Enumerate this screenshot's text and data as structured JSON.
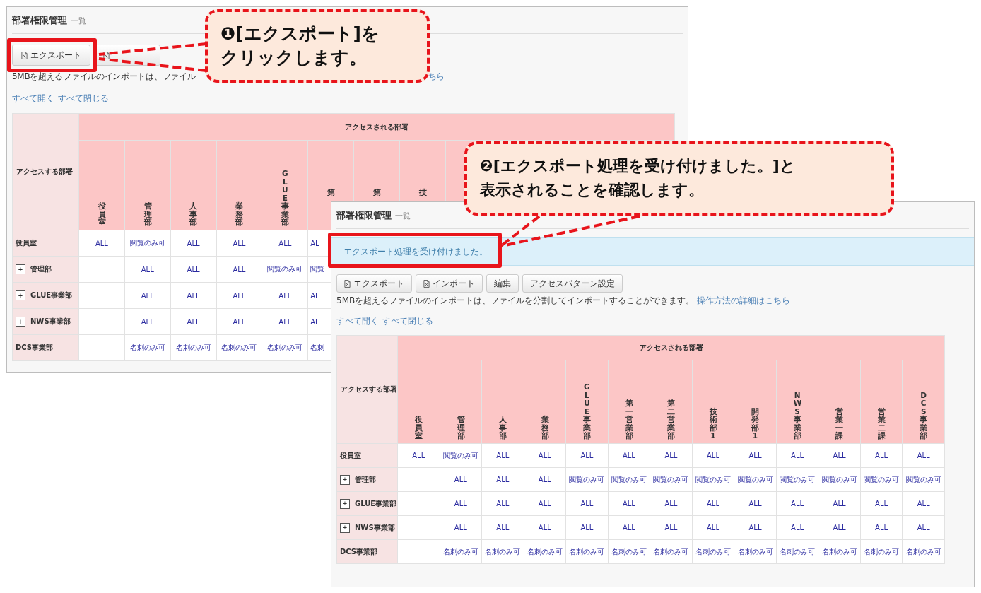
{
  "back_window": {
    "title": "部署権限管理",
    "subtitle": "一覧",
    "buttons": [
      {
        "label": "エクスポート",
        "icon": true
      },
      {
        "icon": true
      }
    ],
    "note": "5MBを超えるファイルのインポートは、ファイル",
    "note_link": "ちら",
    "expand_all": "すべて開く",
    "collapse_all": "すべて閉じる",
    "table": {
      "corner": "アクセスする部署",
      "group_header": "アクセスされる部署",
      "columns": [
        {
          "label": "役員室"
        },
        {
          "label": "管理部"
        },
        {
          "label": "人事部"
        },
        {
          "label": "業務部"
        },
        {
          "label": "GLUE事業部"
        },
        {
          "label": "第",
          "covered": true
        },
        {
          "label": "第",
          "covered": true
        },
        {
          "label": "技",
          "covered": true
        }
      ],
      "rows": [
        {
          "label": "役員室",
          "cells": [
            "ALL",
            "閲覧のみ可",
            "ALL",
            "ALL",
            "ALL",
            "AL"
          ]
        },
        {
          "label": "管理部",
          "expander": "+",
          "cells": [
            null,
            "ALL",
            "ALL",
            "ALL",
            "閲覧のみ可",
            "閲覧"
          ]
        },
        {
          "label": "GLUE事業部",
          "expander": "+",
          "cells": [
            null,
            "ALL",
            "ALL",
            "ALL",
            "ALL",
            "AL"
          ]
        },
        {
          "label": "NWS事業部",
          "expander": "+",
          "cells": [
            null,
            "ALL",
            "ALL",
            "ALL",
            "ALL",
            "AL"
          ]
        },
        {
          "label": "DCS事業部",
          "cells": [
            null,
            "名刺のみ可",
            "名刺のみ可",
            "名刺のみ可",
            "名刺のみ可",
            "名刺"
          ]
        }
      ]
    }
  },
  "front_window": {
    "title": "部署権限管理",
    "subtitle": "一覧",
    "message": "エクスポート処理を受け付けました。",
    "buttons": [
      {
        "label": "エクスポート",
        "icon": true
      },
      {
        "label": "インポート",
        "icon": true
      },
      {
        "label": "編集",
        "icon": false
      },
      {
        "label": "アクセスパターン設定",
        "icon": false
      }
    ],
    "note": "5MBを超えるファイルのインポートは、ファイルを分割してインポートすることができます。",
    "note_link": "操作方法の詳細はこちら",
    "expand_all": "すべて開く",
    "collapse_all": "すべて閉じる",
    "table": {
      "corner": "アクセスする部署",
      "group_header": "アクセスされる部署",
      "columns": [
        {
          "label": "役員室"
        },
        {
          "label": "管理部"
        },
        {
          "label": "人事部"
        },
        {
          "label": "業務部"
        },
        {
          "label": "GLUE事業部"
        },
        {
          "label": "第一営業部"
        },
        {
          "label": "第二営業部"
        },
        {
          "label": "技術部1"
        },
        {
          "label": "開発部1"
        },
        {
          "label": "NWS事業部"
        },
        {
          "label": "営業一課"
        },
        {
          "label": "営業二課"
        },
        {
          "label": "DCS事業部"
        }
      ],
      "rows": [
        {
          "label": "役員室",
          "cells": [
            "ALL",
            "閲覧のみ可",
            "ALL",
            "ALL",
            "ALL",
            "ALL",
            "ALL",
            "ALL",
            "ALL",
            "ALL",
            "ALL",
            "ALL",
            "ALL"
          ]
        },
        {
          "label": "管理部",
          "expander": "+",
          "cells": [
            null,
            "ALL",
            "ALL",
            "ALL",
            "閲覧のみ可",
            "閲覧のみ可",
            "閲覧のみ可",
            "閲覧のみ可",
            "閲覧のみ可",
            "閲覧のみ可",
            "閲覧のみ可",
            "閲覧のみ可",
            "閲覧のみ可"
          ]
        },
        {
          "label": "GLUE事業部",
          "expander": "+",
          "cells": [
            null,
            "ALL",
            "ALL",
            "ALL",
            "ALL",
            "ALL",
            "ALL",
            "ALL",
            "ALL",
            "ALL",
            "ALL",
            "ALL",
            "ALL"
          ]
        },
        {
          "label": "NWS事業部",
          "expander": "+",
          "cells": [
            null,
            "ALL",
            "ALL",
            "ALL",
            "ALL",
            "ALL",
            "ALL",
            "ALL",
            "ALL",
            "ALL",
            "ALL",
            "ALL",
            "ALL"
          ]
        },
        {
          "label": "DCS事業部",
          "cells": [
            null,
            "名刺のみ可",
            "名刺のみ可",
            "名刺のみ可",
            "名刺のみ可",
            "名刺のみ可",
            "名刺のみ可",
            "名刺のみ可",
            "名刺のみ可",
            "名刺のみ可",
            "名刺のみ可",
            "名刺のみ可",
            "名刺のみ可"
          ]
        }
      ]
    }
  },
  "callouts": [
    {
      "lines": [
        "❶[エクスポート]を",
        "クリックします。"
      ]
    },
    {
      "lines": [
        "❷[エクスポート処理を受け付けました。]と",
        "表示されることを確認します。"
      ]
    }
  ]
}
